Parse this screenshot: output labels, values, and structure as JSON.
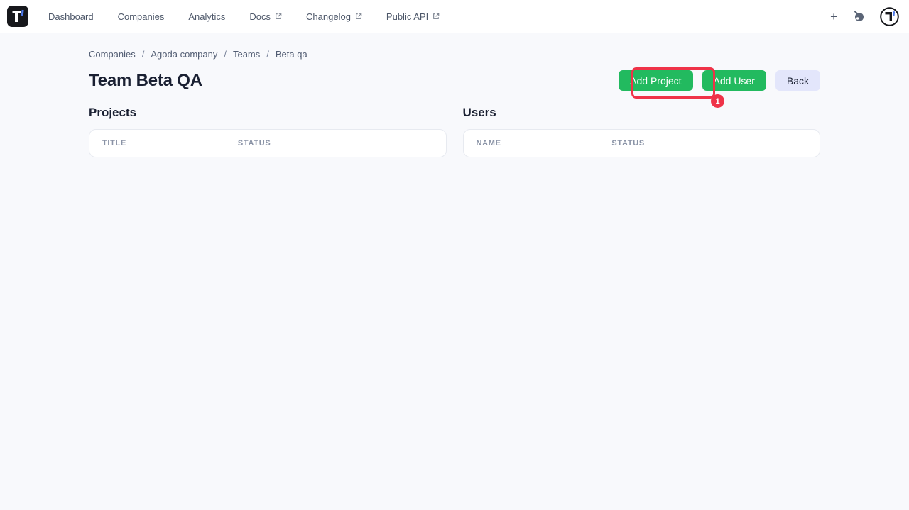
{
  "navbar": {
    "items": [
      {
        "label": "Dashboard",
        "external": false
      },
      {
        "label": "Companies",
        "external": false
      },
      {
        "label": "Analytics",
        "external": false
      },
      {
        "label": "Docs",
        "external": true
      },
      {
        "label": "Changelog",
        "external": true
      },
      {
        "label": "Public API",
        "external": true
      }
    ],
    "add_glyph": "+"
  },
  "breadcrumb": {
    "items": [
      "Companies",
      "Agoda company",
      "Teams",
      "Beta qa"
    ],
    "separator": "/"
  },
  "page": {
    "title": "Team Beta QA"
  },
  "actions": {
    "add_project": "Add Project",
    "add_user": "Add User",
    "back": "Back"
  },
  "projects": {
    "heading": "Projects",
    "columns": [
      "TITLE",
      "STATUS"
    ],
    "rows": []
  },
  "users": {
    "heading": "Users",
    "columns": [
      "NAME",
      "STATUS"
    ],
    "rows": []
  },
  "annotation": {
    "badge": "1"
  },
  "colors": {
    "accent_green": "#22ba5f",
    "annotation_red": "#ef3348",
    "back_btn_bg": "#e3e6fb",
    "brand_black": "#17181c",
    "brand_blue": "#4a77e8",
    "page_bg": "#f8f9fc"
  }
}
